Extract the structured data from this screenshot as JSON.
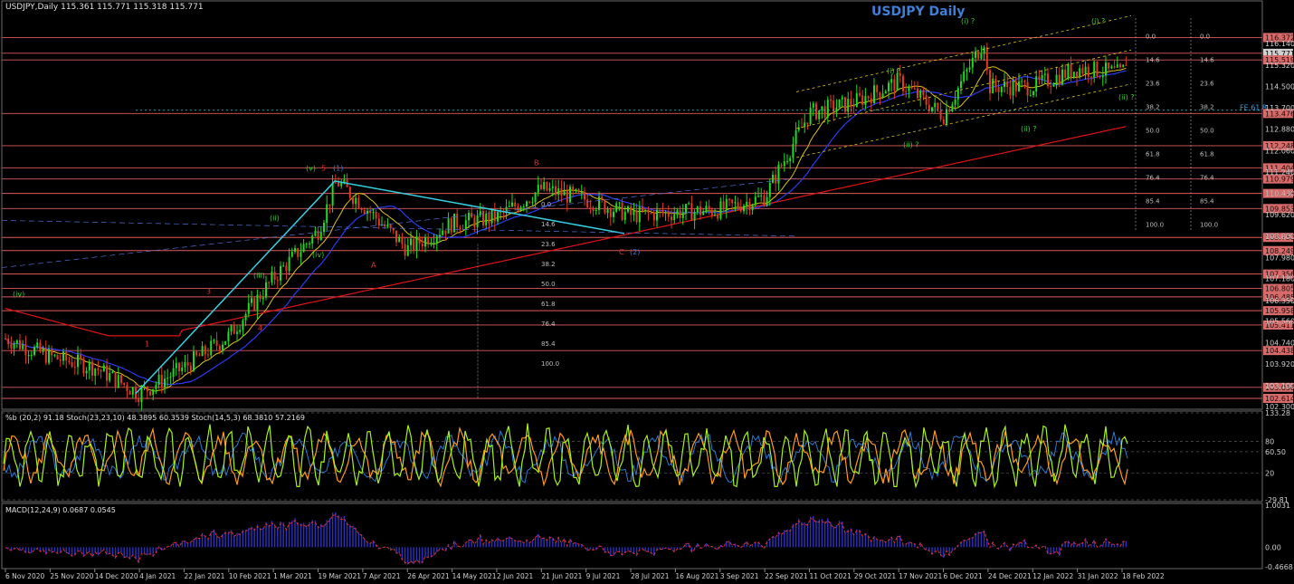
{
  "header": {
    "symbol_info": "USDJPY,Daily  115.361 115.771 115.318 115.771",
    "title": "USDJPY Daily"
  },
  "indicators": {
    "oscillator_label": "%b (20,2) 91.18  Stoch(23,23,10) 48.3895 60.3539  Stoch(14,5,3) 68.3810 57.2169",
    "macd_label": "MACD(12,24,9) 0.0687 0.0545"
  },
  "colors": {
    "background": "#000000",
    "bull_candle": "#1fdc1f",
    "bear_candle": "#e03a20",
    "level_line": "#e05a5a",
    "price_label_bg": "#d96a6a",
    "ma_red": "#e01515",
    "ma_blue": "#2a3cf0",
    "ma_yellow": "#d9c21a",
    "channel": "#d9c21a",
    "wave_line": "#35d0e0",
    "stoch_green": "#a6f21a",
    "stoch_orange": "#ff9a1a",
    "stoch_blue": "#2a7ad6",
    "macd_hist": "#3030c0",
    "macd_signal": "#e03030"
  },
  "chart_data": [
    {
      "type": "candlestick",
      "title": "USDJPY Daily",
      "ylim": [
        102.2,
        117.25
      ],
      "x_tick_labels": [
        "6 Nov 2020",
        "25 Nov 2020",
        "14 Dec 2020",
        "4 Jan 2021",
        "22 Jan 2021",
        "10 Feb 2021",
        "1 Mar 2021",
        "19 Mar 2021",
        "7 Apr 2021",
        "26 Apr 2021",
        "14 May 2021",
        "2 Jun 2021",
        "21 Jun 2021",
        "9 Jul 2021",
        "28 Jul 2021",
        "16 Aug 2021",
        "3 Sep 2021",
        "22 Sep 2021",
        "11 Oct 2021",
        "29 Oct 2021",
        "17 Nov 2021",
        "6 Dec 2021",
        "24 Dec 2021",
        "12 Jan 2022",
        "31 Jan 2022",
        "18 Feb 2022"
      ],
      "y_tick_labels": [
        "116.140",
        "115.320",
        "114.500",
        "113.700",
        "112.880",
        "112.060",
        "111.240",
        "110.430",
        "109.620",
        "108.800",
        "107.980",
        "107.180",
        "106.350",
        "105.560",
        "104.740",
        "103.920",
        "103.100",
        "102.300"
      ],
      "level_labels": [
        "116.372",
        "115.771",
        "115.519",
        "113.476",
        "112.248",
        "111.404",
        "110.979",
        "110.428",
        "109.853",
        "108.750",
        "108.249",
        "107.356",
        "106.805",
        "106.485",
        "105.958",
        "105.411",
        "104.438",
        "103.036",
        "102.614"
      ],
      "key_points": [
        {
          "x": "6 Nov 2020",
          "close": 104.9
        },
        {
          "x": "25 Nov 2020",
          "close": 104.2
        },
        {
          "x": "14 Dec 2020",
          "close": 103.8
        },
        {
          "x": "4 Jan 2021",
          "close": 102.8
        },
        {
          "x": "22 Jan 2021",
          "close": 103.8
        },
        {
          "x": "10 Feb 2021",
          "close": 105.0
        },
        {
          "x": "1 Mar 2021",
          "close": 107.2
        },
        {
          "x": "19 Mar 2021",
          "close": 109.0
        },
        {
          "x": "31 Mar 2021",
          "close": 110.9
        },
        {
          "x": "7 Apr 2021",
          "close": 110.0
        },
        {
          "x": "26 Apr 2021",
          "close": 108.3
        },
        {
          "x": "14 May 2021",
          "close": 109.3
        },
        {
          "x": "2 Jun 2021",
          "close": 109.5
        },
        {
          "x": "21 Jun 2021",
          "close": 110.6
        },
        {
          "x": "9 Jul 2021",
          "close": 110.2
        },
        {
          "x": "28 Jul 2021",
          "close": 109.6
        },
        {
          "x": "16 Aug 2021",
          "close": 109.7
        },
        {
          "x": "3 Sep 2021",
          "close": 109.8
        },
        {
          "x": "22 Sep 2021",
          "close": 110.3
        },
        {
          "x": "11 Oct 2021",
          "close": 113.5
        },
        {
          "x": "29 Oct 2021",
          "close": 113.9
        },
        {
          "x": "17 Nov 2021",
          "close": 114.7
        },
        {
          "x": "6 Dec 2021",
          "close": 113.4
        },
        {
          "x": "24 Dec 2021",
          "close": 114.5
        },
        {
          "x": "4 Jan 2022",
          "close": 116.3
        },
        {
          "x": "12 Jan 2022",
          "close": 114.5
        },
        {
          "x": "31 Jan 2022",
          "close": 115.2
        },
        {
          "x": "18 Feb 2022",
          "close": 115.0
        },
        {
          "x": "1 Mar 2022",
          "close": 115.77
        }
      ],
      "wave_labels": [
        "(iv)",
        "1",
        "3",
        "4",
        "5",
        "(v)",
        "(1)",
        "(ii)",
        "(iii)",
        "(iv)",
        "A",
        "B",
        "C",
        "(2)",
        "(i) ?",
        "(ii) ?",
        "(i) ?",
        "(ii) ?",
        "(i) ?",
        "(ii) ?",
        "FE 61.8"
      ],
      "fib_labels": [
        "0.0",
        "14.6",
        "23.6",
        "38.2",
        "50.0",
        "61.8",
        "76.4",
        "85.4",
        "100.0"
      ]
    },
    {
      "type": "line",
      "title": "%b (20,2) 91.18  Stoch(23,23,10) 48.3895 60.3539  Stoch(14,5,3) 68.3810 57.2169",
      "y_tick_labels": [
        "133.28",
        "80",
        "60.50",
        "20",
        "-29.81"
      ]
    },
    {
      "type": "bar",
      "title": "MACD(12,24,9) 0.0687 0.0545",
      "y_tick_labels": [
        "1.0031",
        "0.00",
        "-0.4668"
      ]
    }
  ]
}
